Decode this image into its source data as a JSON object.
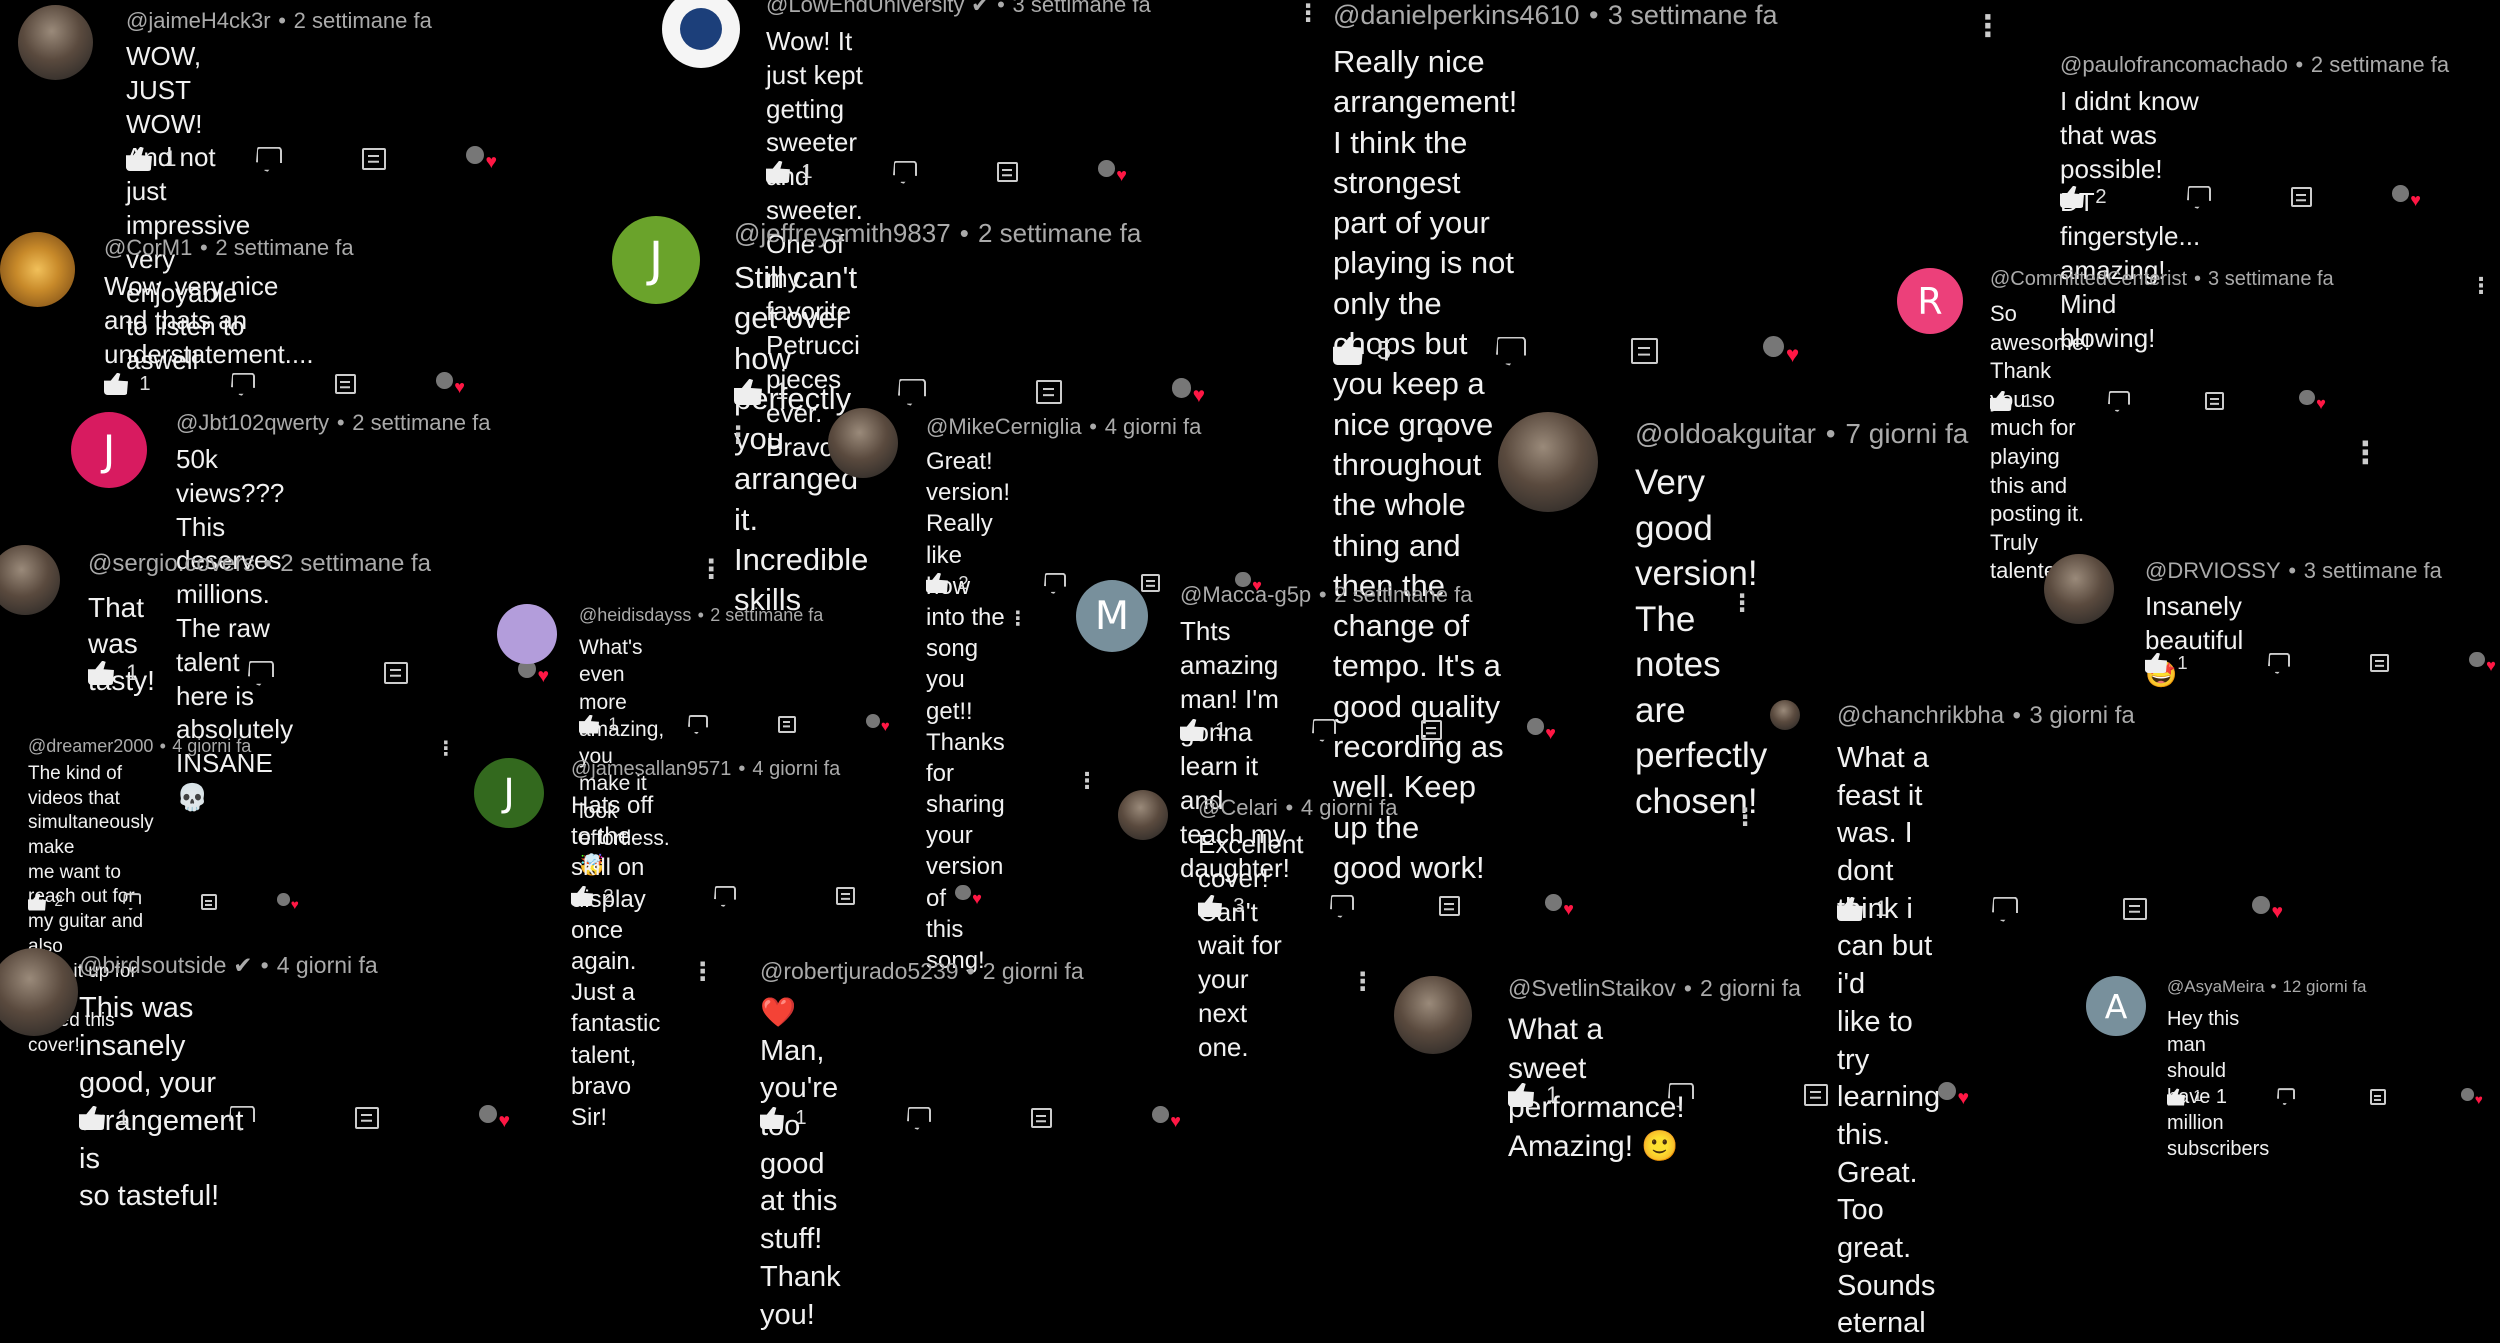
{
  "meta_sep": "•",
  "heart_glyph": "♥",
  "more_glyph": "⋮",
  "comments": [
    {
      "handle": "@jaimeH4ck3r",
      "time": "2 settimane fa",
      "text": "WOW, JUST WOW! And not just impressive\nvery enjoyable to listen to aswell",
      "likes": "1",
      "avatar": {
        "type": "photo",
        "letter": "",
        "color": "#555"
      }
    },
    {
      "handle": "@LowEndUniversity",
      "verified": "✔",
      "time": "3 settimane fa",
      "text": "Wow! It just kept getting sweeter and\nsweeter. One of my favorite Petrucci pieces\never. Bravo!!",
      "likes": "1",
      "avatar": {
        "type": "logo",
        "letter": "",
        "color": "#1c3f7a"
      }
    },
    {
      "handle": "@danielperkins4610",
      "time": "3 settimane fa",
      "text": "Really nice arrangement! I think the strongest\npart of your playing is not only the chops but\nyou keep a nice groove throughout the whole\nthing and then the change of tempo. It's a\ngood quality recording as well. Keep up the\ngood work!",
      "likes": "5",
      "avatar": {
        "type": "none",
        "letter": "",
        "color": "#000"
      }
    },
    {
      "handle": "@paulofrancomachado",
      "time": "2 settimane fa",
      "text": "I didnt know that was possible! DT\nfingerstyle... amazing! Mind blowing!",
      "likes": "2",
      "avatar": {
        "type": "none",
        "letter": "",
        "color": "#000"
      }
    },
    {
      "handle": "@CorM1",
      "time": "2 settimane fa",
      "text": "Wow, very nice and thats an\nunderstatement....",
      "likes": "1",
      "avatar": {
        "type": "guitar",
        "letter": "",
        "color": "#c88a2a"
      }
    },
    {
      "handle": "@jeffreysmith9837",
      "time": "2 settimane fa",
      "text": "Still can't get over how perfectly you\narranged it. Incredible skills",
      "likes": "1",
      "avatar": {
        "type": "letter",
        "letter": "J",
        "color": "#6aa32b"
      }
    },
    {
      "handle": "@CommittedCenterist",
      "time": "3 settimane fa",
      "text": "So awesome! Thank you so much for playing\nthis and posting it. Truly talented!",
      "likes": "1",
      "avatar": {
        "type": "letter",
        "letter": "R",
        "color": "#ec407a"
      }
    },
    {
      "handle": "@Jbt102qwerty",
      "time": "2 settimane fa",
      "text": "50k views??? This deserves millions. The raw\ntalent here is absolutely INSANE 💀",
      "likes": "",
      "avatar": {
        "type": "letter",
        "letter": "J",
        "color": "#d81b60"
      }
    },
    {
      "handle": "@MikeCerniglia",
      "time": "4 giorni fa",
      "text": "Great! version!  Really like how into the song\nyou get!! Thanks for sharing your version of\nthis song!",
      "likes": "2",
      "avatar": {
        "type": "photo",
        "letter": "",
        "color": "#555"
      }
    },
    {
      "handle": "@oldoakguitar",
      "time": "7 giorni fa",
      "text": "Very good version! The notes are perfectly\nchosen!",
      "likes": "",
      "avatar": {
        "type": "photo",
        "letter": "",
        "color": "#555"
      }
    },
    {
      "handle": "@sergio.covers",
      "time": "2 settimane fa",
      "text": "That was tasty!",
      "likes": "1",
      "avatar": {
        "type": "photo",
        "letter": "",
        "color": "#555"
      }
    },
    {
      "handle": "@heidisdayss",
      "time": "2 settimane fa",
      "text": "What's even more amazing, you make it look\neffortless. 🤯",
      "likes": "1",
      "avatar": {
        "type": "letter",
        "letter": "",
        "color": "#b39ddb"
      }
    },
    {
      "handle": "@Macca-g5p",
      "time": "2 settimane fa",
      "text": "Thts amazing man! I'm gonna learn it and\nteach my daughter!",
      "likes": "1",
      "avatar": {
        "type": "letter",
        "letter": "M",
        "color": "#78909c"
      }
    },
    {
      "handle": "@DRVIOSSY",
      "time": "3 settimane fa",
      "text": "Insanely beautiful 🤩",
      "likes": "1",
      "avatar": {
        "type": "photo",
        "letter": "",
        "color": "#555"
      }
    },
    {
      "handle": "@dreamer2000",
      "time": "4 giorni fa",
      "text": "The kind of videos that simultaneously make\nme want to reach out for my guitar and also\npack it up for good.\nLoved this cover!",
      "likes": "2",
      "avatar": {
        "type": "none",
        "letter": "",
        "color": "#000"
      }
    },
    {
      "handle": "@jamesallan9571",
      "time": "4 giorni fa",
      "text": "Hats off to the skill on display once again.\nJust a fantastic talent, bravo Sir!",
      "likes": "2",
      "avatar": {
        "type": "letter",
        "letter": "J",
        "color": "#33691e"
      }
    },
    {
      "handle": "@Celari",
      "time": "4 giorni fa",
      "text": "Excellent cover! Can't wait for your next one.",
      "likes": "3",
      "avatar": {
        "type": "photo",
        "letter": "",
        "color": "#555"
      }
    },
    {
      "handle": "@chanchrikbha",
      "time": "3 giorni fa",
      "text": "What a feast it was. I dont think i can but i'd\nlike to try learning this. Great. Too great.\nSounds eternal",
      "likes": "1",
      "avatar": {
        "type": "photo",
        "letter": "",
        "color": "#555"
      }
    },
    {
      "handle": "@birdsoutside",
      "verified": "✔",
      "time": "4 giorni fa",
      "text": "This was insanely good, your arrangement is\nso tasteful!",
      "likes": "1",
      "avatar": {
        "type": "photo",
        "letter": "",
        "color": "#555"
      }
    },
    {
      "handle": "@robertjurado5239",
      "time": "2 giorni fa",
      "text": "❤️ Man, you're too good at this stuff!  Thank\nyou!",
      "likes": "1",
      "avatar": {
        "type": "none",
        "letter": "",
        "color": "#000"
      }
    },
    {
      "handle": "@SvetlinStaikov",
      "time": "2 giorni fa",
      "text": "What a sweet performance! Amazing! 🙂",
      "likes": "1",
      "avatar": {
        "type": "photo",
        "letter": "",
        "color": "#555"
      }
    },
    {
      "handle": "@AsyaMeira",
      "time": "12 giorni fa",
      "text": "Hey this man should have 1 million\nsubscribers",
      "likes": "1",
      "avatar": {
        "type": "letter",
        "letter": "A",
        "color": "#78909c"
      }
    }
  ]
}
